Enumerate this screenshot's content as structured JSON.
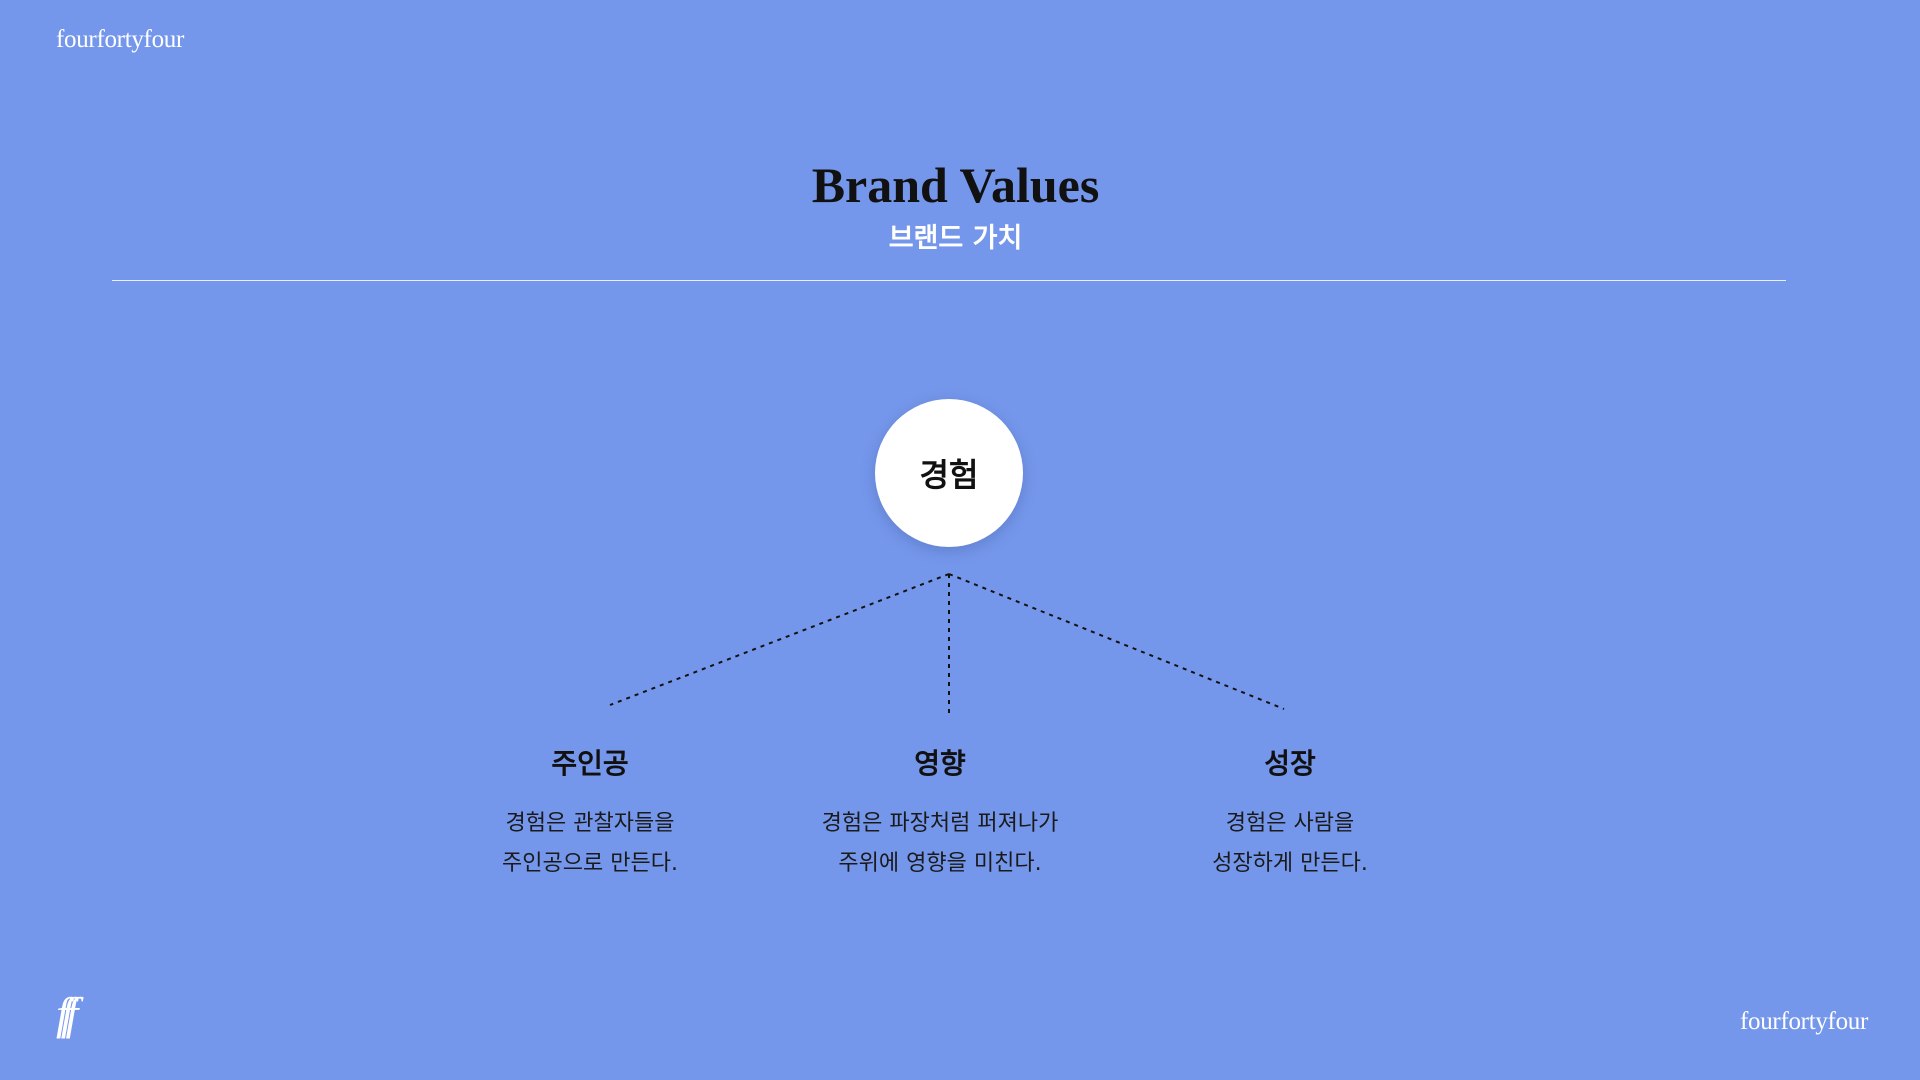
{
  "brand": {
    "logo_top": "fourfortyfour",
    "logo_bottom": "fourfortyfour",
    "monogram": "fff"
  },
  "header": {
    "title": "Brand Values",
    "subtitle": "브랜드 가치"
  },
  "diagram": {
    "root": "경험",
    "branches": [
      {
        "title": "주인공",
        "lines": [
          "경험은 관찰자들을",
          "주인공으로 만든다."
        ]
      },
      {
        "title": "영향",
        "lines": [
          "경험은 파장처럼 퍼져나가",
          "주위에 영향을 미친다."
        ]
      },
      {
        "title": "성장",
        "lines": [
          "경험은 사람을",
          "성장하게 만든다."
        ]
      }
    ]
  },
  "colors": {
    "background": "#7597EB",
    "text": "#111111",
    "white": "#FFFFFF"
  }
}
